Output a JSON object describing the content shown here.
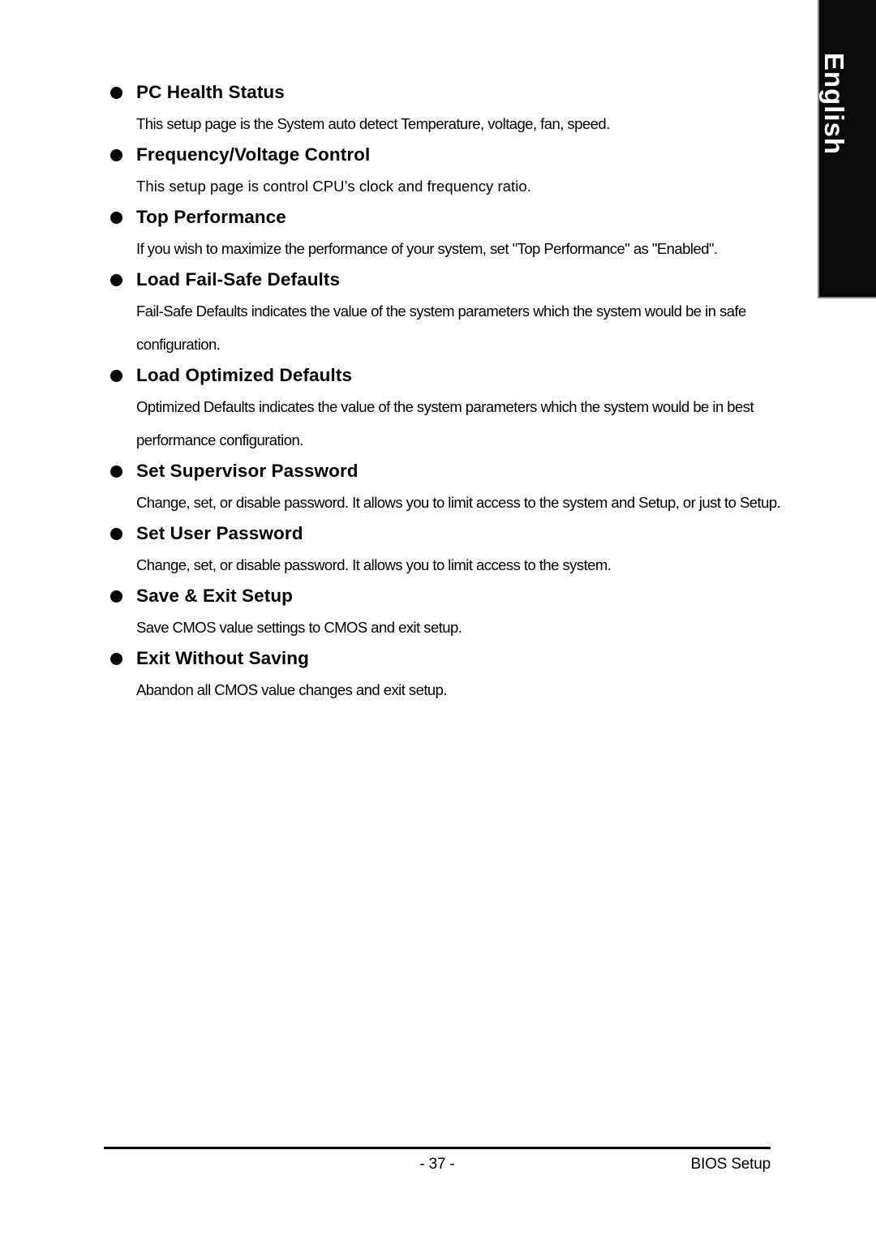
{
  "page": {
    "language_tab": "English",
    "footer": {
      "page_number": "- 37 -",
      "section_name": "BIOS Setup"
    }
  },
  "sections": [
    {
      "heading": "PC Health Status",
      "body": "This setup page is the System auto detect Temperature, voltage, fan, speed."
    },
    {
      "heading": "Frequency/Voltage Control",
      "body": "This setup page is control CPU’s clock and frequency ratio."
    },
    {
      "heading": "Top Performance",
      "body": "If you wish to maximize the performance of your system, set \"Top Performance\" as \"Enabled\"."
    },
    {
      "heading": "Load Fail-Safe Defaults",
      "body": "Fail-Safe Defaults indicates the value of the system parameters which the system would be in safe configuration."
    },
    {
      "heading": "Load Optimized Defaults",
      "body": "Optimized Defaults indicates the value of the system parameters which the system would be in best performance configuration."
    },
    {
      "heading": "Set Supervisor Password",
      "body": "Change, set, or disable password. It allows you to limit access to the system and Setup, or just to Setup."
    },
    {
      "heading": "Set User Password",
      "body": "Change, set, or disable password. It allows you to limit access to the system."
    },
    {
      "heading": "Save & Exit Setup",
      "body": "Save CMOS value settings to CMOS and exit setup."
    },
    {
      "heading": "Exit Without Saving",
      "body": "Abandon all CMOS value changes and exit setup."
    }
  ]
}
